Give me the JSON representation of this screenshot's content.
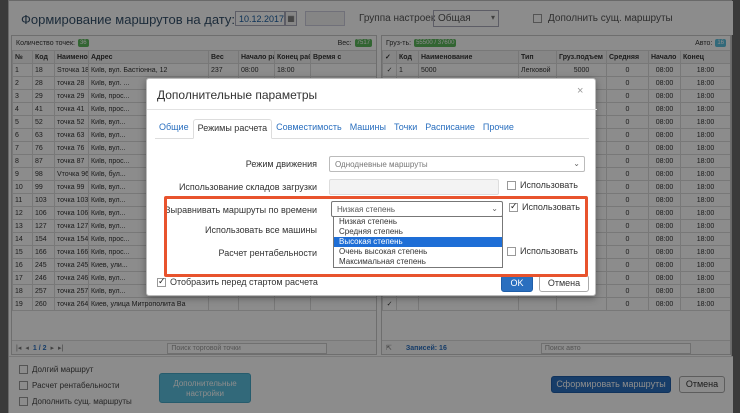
{
  "header": {
    "title": "Формирование маршрутов на дату:",
    "date": "10.12.2017",
    "group_label": "Группа настроек",
    "group_value": "Общая",
    "add_existing_label": "Дополнить сущ. маршруты"
  },
  "left_panel": {
    "count_label": "Количество точек:",
    "count_badge": "36",
    "weight_label": "Вес:",
    "weight_badge": "7517",
    "columns": [
      "№",
      "Код",
      "Наименования",
      "Адрес",
      "Вес",
      "Начало раб",
      "Конец раб",
      "Время с"
    ],
    "rows": [
      [
        "1",
        "18",
        "Sточка 18",
        "Київ, вул. Бастіонна, 12",
        "237",
        "08:00",
        "18:00"
      ],
      [
        "2",
        "28",
        "точка 28",
        "Київ, вул. ...",
        "",
        "",
        "",
        ""
      ],
      [
        "3",
        "29",
        "точка 29",
        "Київ, прос...",
        "",
        "",
        "",
        ""
      ],
      [
        "4",
        "41",
        "точка 41",
        "Київ, прос...",
        "",
        "",
        "",
        ""
      ],
      [
        "5",
        "52",
        "точка 52",
        "Київ, вул...",
        "",
        "",
        "",
        ""
      ],
      [
        "6",
        "63",
        "точка 63",
        "Київ, вул...",
        "",
        "",
        "",
        ""
      ],
      [
        "7",
        "76",
        "точка 76",
        "Київ, вул...",
        "",
        "",
        "",
        ""
      ],
      [
        "8",
        "87",
        "точка 87",
        "Київ, прос...",
        "",
        "",
        "",
        ""
      ],
      [
        "9",
        "98",
        "Vточка 96",
        "Київ, бул...",
        "",
        "",
        "",
        ""
      ],
      [
        "10",
        "99",
        "точка 99",
        "Київ, вул...",
        "",
        "",
        "",
        ""
      ],
      [
        "11",
        "103",
        "точка 103",
        "Київ, вул...",
        "",
        "",
        "",
        ""
      ],
      [
        "12",
        "106",
        "точка 106",
        "Київ, вул...",
        "",
        "",
        "",
        ""
      ],
      [
        "13",
        "127",
        "точка 127",
        "Київ, вул...",
        "",
        "",
        "",
        ""
      ],
      [
        "14",
        "154",
        "точка 154",
        "Київ, прос...",
        "",
        "",
        "",
        ""
      ],
      [
        "15",
        "166",
        "точка 166",
        "Київ, прос...",
        "",
        "",
        "",
        ""
      ],
      [
        "16",
        "245",
        "точка 245",
        "Киев, ули...",
        "",
        "",
        "",
        ""
      ],
      [
        "17",
        "246",
        "точка 246",
        "Київ, вул...",
        "",
        "",
        "",
        ""
      ],
      [
        "18",
        "257",
        "точка 257",
        "Київ, вул...",
        "",
        "",
        "",
        ""
      ],
      [
        "19",
        "260",
        "точка 264",
        "Киев, улица Митрополита Ва",
        "",
        "",
        "",
        ""
      ]
    ],
    "pager": "1 / 2",
    "search_placeholder": "Поиск торговой точки"
  },
  "right_panel": {
    "cargo_label": "Груз-ть:",
    "cargo_badge": "55500 / 37600",
    "auto_label": "Авто:",
    "auto_badge": "16",
    "columns": [
      "",
      "Код",
      "Наименование",
      "Тип",
      "Груз.подъем",
      "Средняя",
      "Начало",
      "Конец"
    ],
    "rows": [
      [
        "",
        "1",
        "5000",
        "Легковой",
        "5000",
        "0",
        "08:00",
        "18:00"
      ],
      [
        "",
        "",
        "",
        "",
        "",
        "0",
        "08:00",
        "18:00"
      ],
      [
        "",
        "",
        "",
        "",
        "",
        "0",
        "08:00",
        "18:00"
      ],
      [
        "",
        "",
        "",
        "",
        "",
        "0",
        "08:00",
        "18:00"
      ],
      [
        "",
        "",
        "",
        "",
        "",
        "0",
        "08:00",
        "18:00"
      ],
      [
        "",
        "",
        "",
        "",
        "",
        "0",
        "08:00",
        "18:00"
      ],
      [
        "",
        "",
        "",
        "",
        "",
        "0",
        "08:00",
        "18:00"
      ],
      [
        "",
        "",
        "",
        "",
        "",
        "0",
        "08:00",
        "18:00"
      ],
      [
        "",
        "",
        "",
        "",
        "",
        "0",
        "08:00",
        "18:00"
      ],
      [
        "",
        "",
        "",
        "",
        "",
        "0",
        "08:00",
        "18:00"
      ],
      [
        "",
        "",
        "",
        "",
        "",
        "0",
        "08:00",
        "18:00"
      ],
      [
        "",
        "",
        "",
        "",
        "",
        "0",
        "08:00",
        "18:00"
      ],
      [
        "",
        "",
        "",
        "",
        "",
        "0",
        "08:00",
        "18:00"
      ],
      [
        "",
        "",
        "",
        "",
        "",
        "0",
        "08:00",
        "18:00"
      ],
      [
        "",
        "",
        "",
        "",
        "",
        "0",
        "08:00",
        "18:00"
      ],
      [
        "",
        "",
        "",
        "",
        "",
        "0",
        "08:00",
        "18:00"
      ],
      [
        "",
        "",
        "",
        "",
        "",
        "0",
        "08:00",
        "18:00"
      ],
      [
        "",
        "",
        "",
        "",
        "",
        "0",
        "08:00",
        "18:00"
      ],
      [
        "",
        "",
        "",
        "",
        "",
        "0",
        "08:00",
        "18:00"
      ]
    ],
    "records_label": "Записей: 16",
    "search_placeholder": "Поиск авто"
  },
  "bottom": {
    "long_route": "Долгий маршрут",
    "profitability": "Расчет рентабельности",
    "add_existing": "Дополнить сущ. маршруты",
    "additional_settings": "Дополнительные настройки",
    "form_routes": "Сформировать маршруты",
    "cancel": "Отмена"
  },
  "dialog": {
    "title": "Дополнительные параметры",
    "close": "×",
    "tabs": [
      "Общие",
      "Режимы расчета",
      "Совместимость",
      "Машины",
      "Точки",
      "Расписание",
      "Прочие"
    ],
    "active_tab": "Режимы расчета",
    "mode_label": "Режим движения",
    "mode_value": "Однодневные маршруты",
    "warehouses_label": "Использование складов загрузки",
    "use_label": "Использовать",
    "align_label": "Выравнивать маршруты по времени",
    "align_value": "Низкая степень",
    "all_cars_label": "Использовать все машины",
    "profit_label": "Расчет рентабельности",
    "dropdown_options": [
      "Низкая степень",
      "Средняя степень",
      "Высокая степень",
      "Очень высокая степень",
      "Максимальная степень"
    ],
    "highlighted_option": "Высокая степень",
    "show_before_label": "Отобразить перед стартом расчета",
    "ok": "OK",
    "cancel": "Отмена"
  },
  "colors": {
    "primary": "#2a6fbf",
    "info": "#5bc0de",
    "highlight": "#e8532d",
    "selected_option": "#1e6ed6"
  }
}
